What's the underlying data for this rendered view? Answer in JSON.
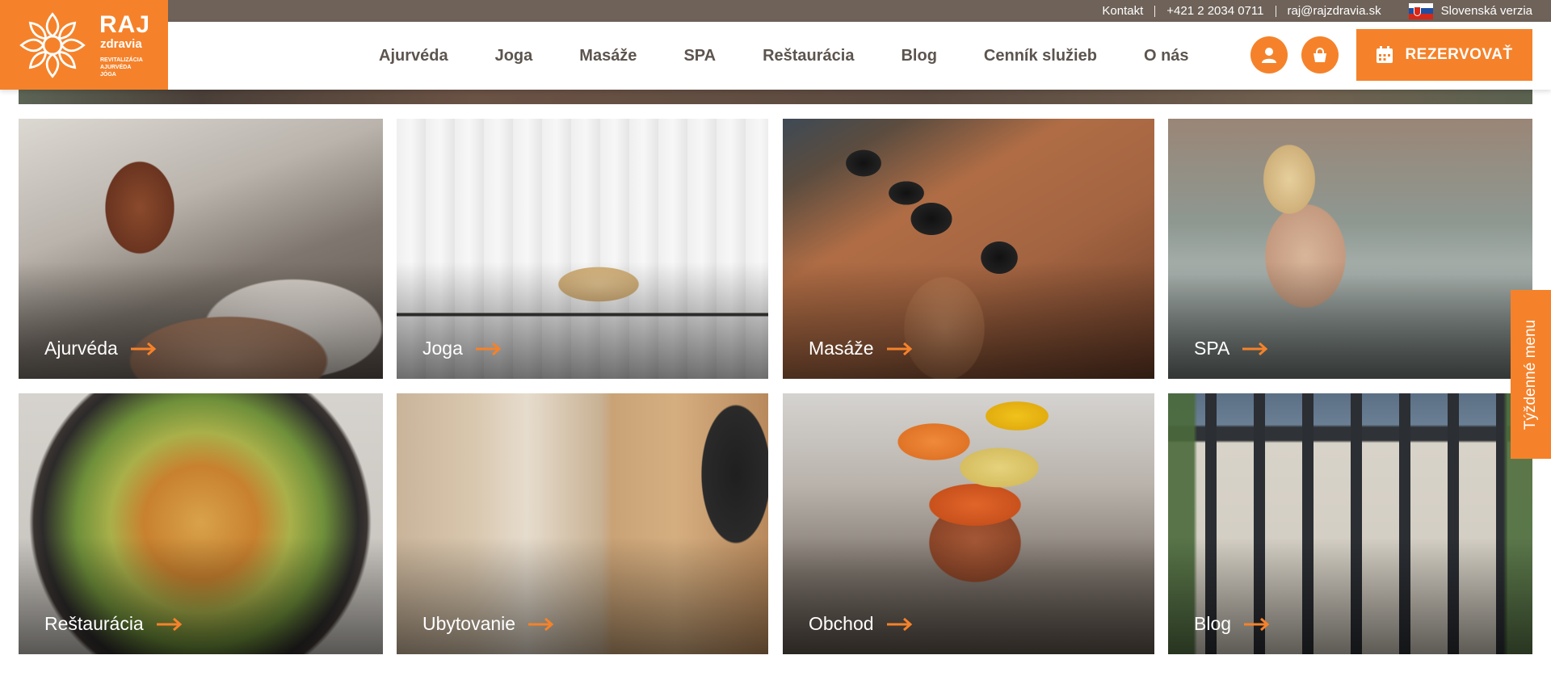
{
  "colors": {
    "accent": "#f5822a",
    "topbar": "#6e6259",
    "nav_text": "#5c544e"
  },
  "topbar": {
    "contact": "Kontakt",
    "phone": "+421 2 2034 0711",
    "email": "raj@rajzdravia.sk",
    "language": "Slovenská verzia",
    "flag_icon": "slovak-flag-icon"
  },
  "logo": {
    "brand_line1": "RAJ",
    "brand_line2": "zdravia",
    "tagline": [
      "REVITALIZÁCIA",
      "AJURVÉDA",
      "JÓGA"
    ]
  },
  "nav": {
    "items": [
      "Ajurvéda",
      "Joga",
      "Masáže",
      "SPA",
      "Reštaurácia",
      "Blog",
      "Cenník služieb",
      "O nás"
    ]
  },
  "header_actions": {
    "account_icon": "user-icon",
    "cart_icon": "shopping-bag-icon",
    "reserve_label": "REZERVOVAŤ",
    "reserve_icon": "calendar-icon"
  },
  "tiles": [
    {
      "label": "Ajurvéda",
      "image": "ayurveda-oil-treatment"
    },
    {
      "label": "Joga",
      "image": "yoga-child-pose"
    },
    {
      "label": "Masáže",
      "image": "hot-stone-massage"
    },
    {
      "label": "SPA",
      "image": "woman-in-whirlpool"
    },
    {
      "label": "Reštaurácia",
      "image": "vegetable-bowl"
    },
    {
      "label": "Ubytovanie",
      "image": "hotel-room-door"
    },
    {
      "label": "Obchod",
      "image": "spice-bowls"
    },
    {
      "label": "Blog",
      "image": "building-facade"
    }
  ],
  "side_tab": {
    "label": "Týždenné menu"
  }
}
